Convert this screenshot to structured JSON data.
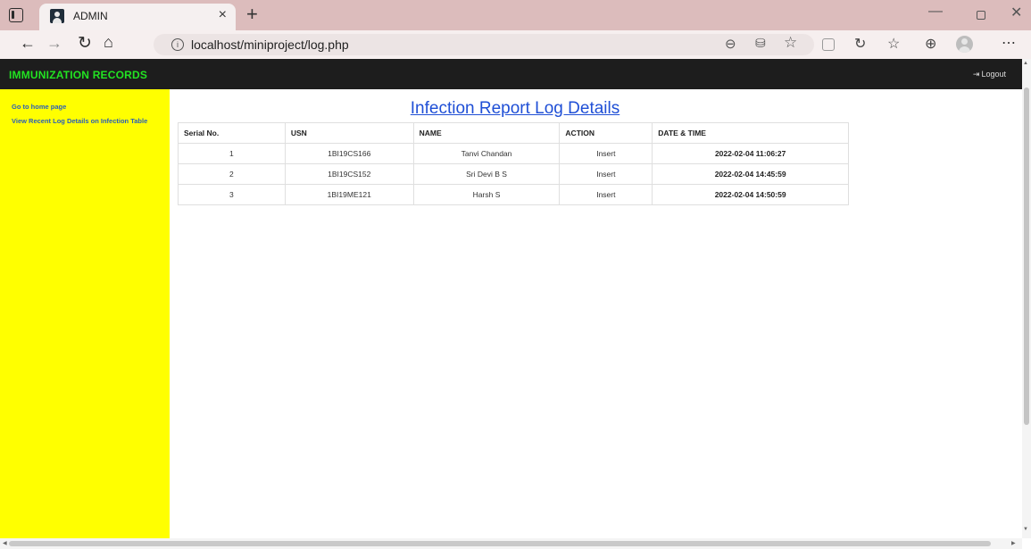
{
  "browser": {
    "tab_title": "ADMIN",
    "tab_close": "×",
    "new_tab": "+",
    "url": "localhost/miniproject/log.php",
    "icons": {
      "back": "←",
      "forward": "→",
      "refresh": "↻",
      "home": "⌂",
      "zoom": "⊖",
      "reader": "⛁",
      "favorite_add": "☆",
      "copilot": "↻",
      "favorites": "☆",
      "collections": "⊕",
      "more": "⋯",
      "info": "i",
      "minimize": "—",
      "close": "✕"
    }
  },
  "page": {
    "brand": "IMMUNIZATION RECORDS",
    "logout_label": "Logout",
    "logout_icon": "⇥",
    "sidebar": {
      "links": [
        {
          "label": "Go to home page"
        },
        {
          "label": "View Recent Log Details on Infection Table"
        }
      ]
    },
    "title": "Infection Report Log Details",
    "table": {
      "headers": [
        "Serial No.",
        "USN",
        "NAME",
        "ACTION",
        "DATE & TIME"
      ],
      "rows": [
        {
          "serial": "1",
          "usn": "1BI19CS166",
          "name": "Tanvi Chandan",
          "action": "Insert",
          "datetime": "2022-02-04 11:06:27"
        },
        {
          "serial": "2",
          "usn": "1BI19CS152",
          "name": "Sri Devi B S",
          "action": "Insert",
          "datetime": "2022-02-04 14:45:59"
        },
        {
          "serial": "3",
          "usn": "1BI19ME121",
          "name": "Harsh S",
          "action": "Insert",
          "datetime": "2022-02-04 14:50:59"
        }
      ]
    }
  },
  "colors": {
    "tabbar": "#dcbcbc",
    "topbar": "#1d1d1d",
    "brand_text": "#22e322",
    "sidebar": "#ffff00",
    "link": "#2a5fb8",
    "title_link": "#1f4fd6"
  }
}
